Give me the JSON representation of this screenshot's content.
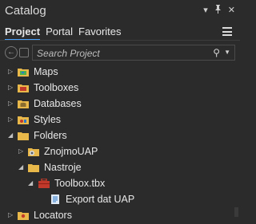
{
  "panel": {
    "title": "Catalog",
    "controls": {
      "pin": "▾",
      "autohide": "⌂",
      "close": "✕"
    }
  },
  "tabs": [
    {
      "label": "Project",
      "active": true
    },
    {
      "label": "Portal",
      "active": false
    },
    {
      "label": "Favorites",
      "active": false
    }
  ],
  "search": {
    "placeholder": "Search Project",
    "icon": "search-icon"
  },
  "tree": [
    {
      "label": "Maps",
      "icon": "map-folder-icon",
      "expanded": false
    },
    {
      "label": "Toolboxes",
      "icon": "toolbox-folder-icon",
      "expanded": false
    },
    {
      "label": "Databases",
      "icon": "database-folder-icon",
      "expanded": false
    },
    {
      "label": "Styles",
      "icon": "style-folder-icon",
      "expanded": false
    },
    {
      "label": "Folders",
      "icon": "folder-icon",
      "expanded": true
    },
    {
      "label": "ZnojmoUAP",
      "icon": "folder-connection-icon",
      "expanded": false
    },
    {
      "label": "Nastroje",
      "icon": "folder-icon",
      "expanded": true
    },
    {
      "label": "Toolbox.tbx",
      "icon": "toolbox-icon",
      "expanded": true
    },
    {
      "label": "Export dat UAP",
      "icon": "script-tool-icon",
      "expanded": false
    },
    {
      "label": "Locators",
      "icon": "locator-folder-icon",
      "expanded": false
    }
  ],
  "colors": {
    "background": "#2b2b2b",
    "accent": "#4aa3ff",
    "folder": "#e8b84a"
  }
}
